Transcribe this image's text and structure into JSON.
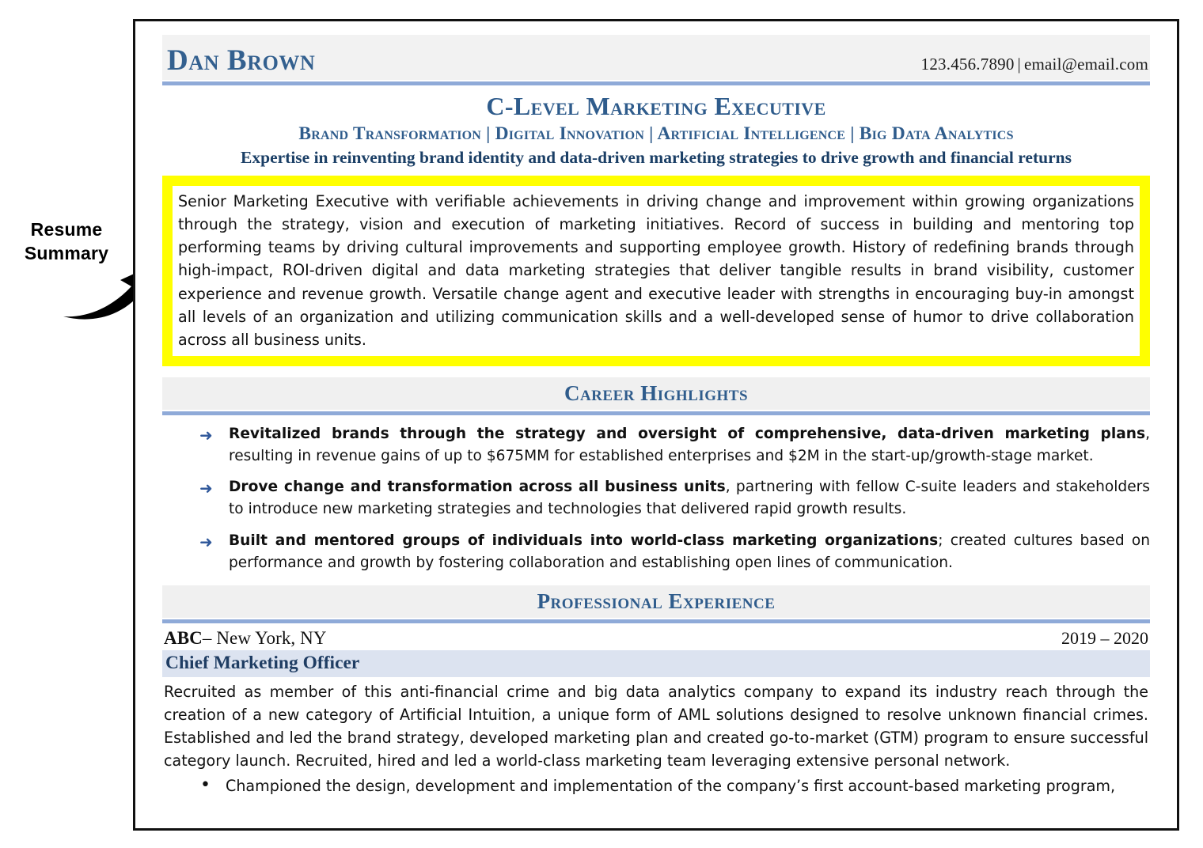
{
  "annotation": {
    "label_line1": "Resume",
    "label_line2": "Summary"
  },
  "colors": {
    "accent_blue": "#2f5c8c",
    "rule_blue": "#8faad8",
    "highlight_yellow": "#ffff00",
    "title_bar_blue": "#dce3f0",
    "band_gray": "#f0f0f0"
  },
  "header": {
    "name": "Dan Brown",
    "phone": "123.456.7890",
    "separator": "|",
    "email": "email@email.com"
  },
  "headline": {
    "main": "C-Level Marketing Executive",
    "sub": "Brand Transformation | Digital Innovation | Artificial Intelligence | Big Data Analytics",
    "tagline": "Expertise in reinventing brand identity and data-driven marketing strategies to drive growth and financial returns"
  },
  "summary": {
    "text": "Senior Marketing Executive with verifiable achievements in driving change and improvement within growing organizations through the strategy, vision and execution of marketing initiatives. Record of success in building and mentoring top performing teams by driving cultural improvements and supporting employee growth. History of redefining brands through high-impact, ROI-driven digital and data marketing strategies that deliver tangible results in brand visibility, customer experience and revenue growth. Versatile change agent and executive leader with strengths in encouraging buy-in amongst all levels of an organization and utilizing communication skills and a well-developed sense of humor to drive collaboration across all business units."
  },
  "career_highlights": {
    "section_title": "Career Highlights",
    "bullet_marker": "arrow-right-icon",
    "items": [
      {
        "bold": "Revitalized brands through the strategy and oversight of comprehensive, data-driven marketing plans",
        "rest": ", resulting in revenue gains of up to $675MM for established enterprises and $2M in the start-up/growth-stage market."
      },
      {
        "bold": "Drove change and transformation across all business units",
        "rest": ", partnering with fellow C-suite leaders and stakeholders to introduce new marketing strategies and technologies that delivered rapid growth results."
      },
      {
        "bold": "Built and mentored groups of individuals into world-class marketing organizations",
        "rest": "; created cultures based on performance and growth by fostering collaboration and establishing open lines of communication."
      }
    ]
  },
  "professional_experience": {
    "section_title": "Professional Experience",
    "job": {
      "company": "ABC",
      "company_dash": "–",
      "location": "New York, NY",
      "dates": "2019 – 2020",
      "title": "Chief Marketing Officer",
      "description": "Recruited as member of this anti-financial crime and big data analytics company to expand its industry reach through the creation of a new category of Artificial Intuition, a unique form of AML solutions designed to resolve unknown financial crimes. Established and led the brand strategy, developed marketing plan and created go-to-market (GTM) program to ensure successful category launch. Recruited, hired and led a world-class marketing team leveraging extensive personal network.",
      "bullet_marker": "dot-icon",
      "bullets": [
        "Championed the design, development and implementation of the company’s first account-based marketing program,"
      ]
    }
  }
}
